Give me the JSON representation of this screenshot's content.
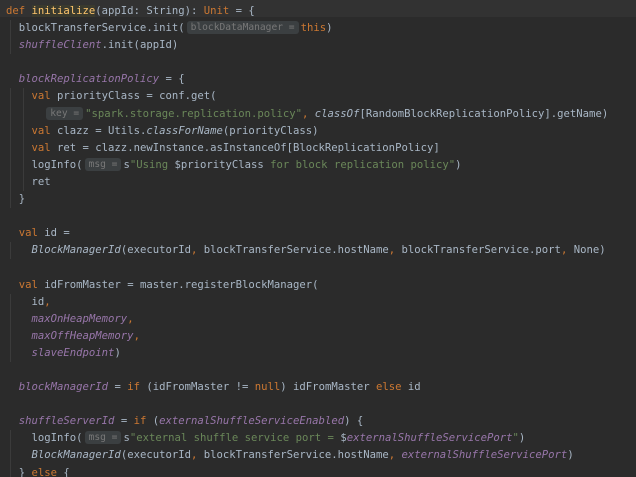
{
  "lines": [
    [
      {
        "c": "kw",
        "t": "def "
      },
      {
        "c": "fn-hl",
        "t": "initialize"
      },
      {
        "c": "",
        "t": "(appId: String): "
      },
      {
        "c": "kw",
        "t": "Unit"
      },
      {
        "c": "",
        "t": " = {"
      }
    ],
    [
      {
        "c": "",
        "t": "  blockTransferService.init("
      },
      {
        "c": "hint",
        "t": "blockDataManager ="
      },
      {
        "c": "kw",
        "t": "this"
      },
      {
        "c": "",
        "t": ")"
      }
    ],
    [
      {
        "c": "field",
        "t": "  shuffleClient"
      },
      {
        "c": "",
        "t": ".init(appId)"
      }
    ],
    [],
    [
      {
        "c": "field",
        "t": "  blockReplicationPolicy"
      },
      {
        "c": "",
        "t": " = {"
      }
    ],
    [
      {
        "c": "kw",
        "t": "    val "
      },
      {
        "c": "",
        "t": "priorityClass = conf.get("
      }
    ],
    [
      {
        "c": "",
        "t": "      "
      },
      {
        "c": "hint",
        "t": "key ="
      },
      {
        "c": "str",
        "t": "\"spark.storage.replication.policy\""
      },
      {
        "c": "kw",
        "t": ", "
      },
      {
        "c": "stat",
        "t": "classOf"
      },
      {
        "c": "",
        "t": "[RandomBlockReplicationPolicy].getName)"
      }
    ],
    [
      {
        "c": "kw",
        "t": "    val "
      },
      {
        "c": "",
        "t": "clazz = Utils."
      },
      {
        "c": "stat",
        "t": "classForName"
      },
      {
        "c": "",
        "t": "(priorityClass)"
      }
    ],
    [
      {
        "c": "kw",
        "t": "    val "
      },
      {
        "c": "",
        "t": "ret = clazz.newInstance.asInstanceOf[BlockReplicationPolicy]"
      }
    ],
    [
      {
        "c": "",
        "t": "    logInfo("
      },
      {
        "c": "hint",
        "t": "msg ="
      },
      {
        "c": "",
        "t": "s"
      },
      {
        "c": "str",
        "t": "\"Using "
      },
      {
        "c": "",
        "t": "$priorityClass"
      },
      {
        "c": "str",
        "t": " for block replication policy\""
      },
      {
        "c": "",
        "t": ")"
      }
    ],
    [
      {
        "c": "",
        "t": "    ret"
      }
    ],
    [
      {
        "c": "",
        "t": "  }"
      }
    ],
    [],
    [
      {
        "c": "kw",
        "t": "  val "
      },
      {
        "c": "",
        "t": "id ="
      }
    ],
    [
      {
        "c": "stat",
        "t": "    BlockManagerId"
      },
      {
        "c": "",
        "t": "(executorId"
      },
      {
        "c": "kw",
        "t": ", "
      },
      {
        "c": "",
        "t": "blockTransferService.hostName"
      },
      {
        "c": "kw",
        "t": ", "
      },
      {
        "c": "",
        "t": "blockTransferService.port"
      },
      {
        "c": "kw",
        "t": ", "
      },
      {
        "c": "",
        "t": "None)"
      }
    ],
    [],
    [
      {
        "c": "kw",
        "t": "  val "
      },
      {
        "c": "",
        "t": "idFromMaster = master.registerBlockManager("
      }
    ],
    [
      {
        "c": "",
        "t": "    id"
      },
      {
        "c": "kw",
        "t": ","
      }
    ],
    [
      {
        "c": "field",
        "t": "    maxOnHeapMemory"
      },
      {
        "c": "kw",
        "t": ","
      }
    ],
    [
      {
        "c": "field",
        "t": "    maxOffHeapMemory"
      },
      {
        "c": "kw",
        "t": ","
      }
    ],
    [
      {
        "c": "field",
        "t": "    slaveEndpoint"
      },
      {
        "c": "",
        "t": ")"
      }
    ],
    [],
    [
      {
        "c": "field",
        "t": "  blockManagerId"
      },
      {
        "c": "",
        "t": " = "
      },
      {
        "c": "kw",
        "t": "if "
      },
      {
        "c": "",
        "t": "(idFromMaster != "
      },
      {
        "c": "kw",
        "t": "null"
      },
      {
        "c": "",
        "t": ") idFromMaster "
      },
      {
        "c": "kw",
        "t": "else "
      },
      {
        "c": "",
        "t": "id"
      }
    ],
    [],
    [
      {
        "c": "field",
        "t": "  shuffleServerId"
      },
      {
        "c": "",
        "t": " = "
      },
      {
        "c": "kw",
        "t": "if "
      },
      {
        "c": "",
        "t": "("
      },
      {
        "c": "field",
        "t": "externalShuffleServiceEnabled"
      },
      {
        "c": "",
        "t": ") {"
      }
    ],
    [
      {
        "c": "",
        "t": "    logInfo("
      },
      {
        "c": "hint",
        "t": "msg ="
      },
      {
        "c": "",
        "t": "s"
      },
      {
        "c": "str",
        "t": "\"external shuffle service port = "
      },
      {
        "c": "",
        "t": "$"
      },
      {
        "c": "field",
        "t": "externalShuffleServicePort"
      },
      {
        "c": "str",
        "t": "\""
      },
      {
        "c": "",
        "t": ")"
      }
    ],
    [
      {
        "c": "stat",
        "t": "    BlockManagerId"
      },
      {
        "c": "",
        "t": "(executorId"
      },
      {
        "c": "kw",
        "t": ", "
      },
      {
        "c": "",
        "t": "blockTransferService.hostName"
      },
      {
        "c": "kw",
        "t": ", "
      },
      {
        "c": "field",
        "t": "externalShuffleServicePort"
      },
      {
        "c": "",
        "t": ")"
      }
    ],
    [
      {
        "c": "",
        "t": "  } "
      },
      {
        "c": "kw",
        "t": "else "
      },
      {
        "c": "",
        "t": "{"
      }
    ]
  ]
}
